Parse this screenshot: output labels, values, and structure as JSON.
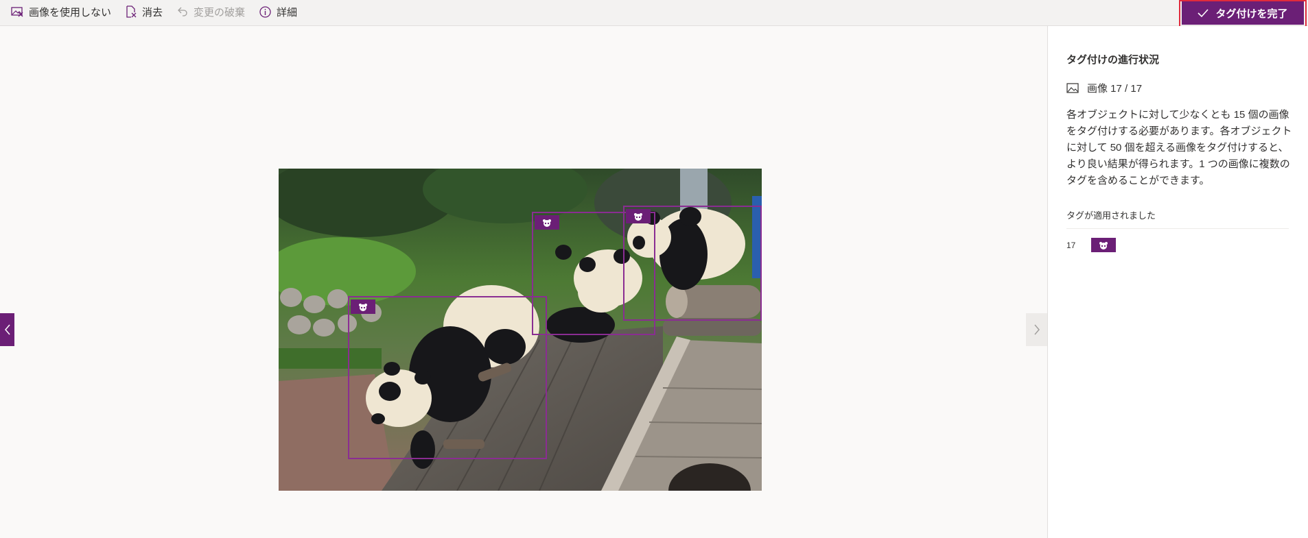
{
  "toolbar": {
    "unused_image_label": "画像を使用しない",
    "clear_label": "消去",
    "discard_label": "変更の破棄",
    "details_label": "詳細",
    "finish_label": "タグ付けを完了"
  },
  "side_panel": {
    "title": "タグ付けの進行状況",
    "image_count": "画像 17 / 17",
    "description": "各オブジェクトに対して少なくとも 15 個の画像をタグ付けする必要があります。各オブジェクトに対して 50 個を超える画像をタグ付けすると、より良い結果が得られます。1 つの画像に複数のタグを含めることができます。",
    "applied_heading": "タグが適用されました",
    "tags": [
      {
        "count": "17",
        "icon": "panda-icon"
      }
    ]
  },
  "colors": {
    "accent": "#6b1f76",
    "bbox": "#8a2d92",
    "highlight_border": "#e02b3c"
  },
  "image": {
    "subject": "giant pandas on wooden house roof",
    "bounding_boxes": 3,
    "tag_icon": "panda-icon"
  }
}
